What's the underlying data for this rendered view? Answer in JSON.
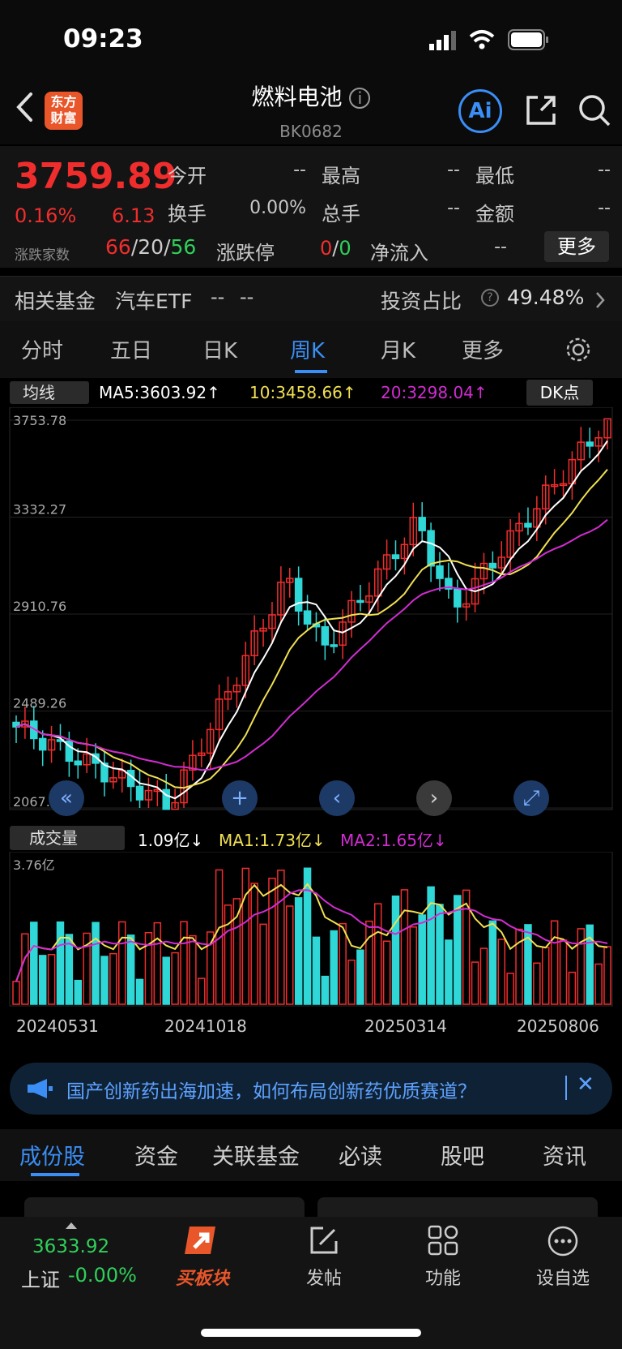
{
  "status_bar": {
    "time": "09:23"
  },
  "header": {
    "logo_text_1": "东方",
    "logo_text_2": "财富",
    "title": "燃料电池",
    "code": "BK0682",
    "ai_label": "Ai"
  },
  "quote": {
    "price": "3759.89",
    "change_pct": "0.16%",
    "change": "6.13",
    "breadth_label": "涨跌家数",
    "up": "66",
    "flat": "20",
    "down": "56",
    "rows": [
      {
        "label": "今开",
        "value": "--"
      },
      {
        "label": "最高",
        "value": "--"
      },
      {
        "label": "最低",
        "value": "--"
      },
      {
        "label": "换手",
        "value": "0.00%"
      },
      {
        "label": "总手",
        "value": "--"
      },
      {
        "label": "金额",
        "value": "--"
      }
    ],
    "limit_label": "涨跌停",
    "limit_up": "0",
    "limit_down": "0",
    "netflow_label": "净流入",
    "netflow_value": "--",
    "more_label": "更多"
  },
  "fund": {
    "label": "相关基金",
    "name": "汽车ETF",
    "v1": "--",
    "v2": "--",
    "ratio_label": "投资占比",
    "ratio": "49.48%"
  },
  "tabs": [
    {
      "label": "分时"
    },
    {
      "label": "五日"
    },
    {
      "label": "日K"
    },
    {
      "label": "周K"
    },
    {
      "label": "月K"
    },
    {
      "label": "更多"
    }
  ],
  "chart_controls": {
    "ma_selector": "均线",
    "ma5": "MA5:3603.92↑",
    "ma10": "10:3458.66↑",
    "ma20": "20:3298.04↑",
    "dk_label": "DK点",
    "vol_selector": "成交量",
    "vol_now": "1.09亿↓",
    "vol_ma1": "MA1:1.73亿↓",
    "vol_ma2": "MA2:1.65亿↓"
  },
  "chart_data": {
    "type": "candlestick",
    "y_ticks": [
      "3753.78",
      "3332.27",
      "2910.76",
      "2489.26",
      "2067.75"
    ],
    "volume_ticks": [
      "3.76亿"
    ],
    "x_ticks": [
      "20240531",
      "20241018",
      "20250314",
      "20250806"
    ],
    "ylim": [
      2067.75,
      3753.78
    ]
  },
  "news": {
    "text": "国产创新药出海加速，如何布局创新药优质赛道？"
  },
  "subtabs": [
    {
      "label": "成份股"
    },
    {
      "label": "资金"
    },
    {
      "label": "关联基金"
    },
    {
      "label": "必读"
    },
    {
      "label": "股吧"
    },
    {
      "label": "资讯"
    }
  ],
  "bottom_nav": {
    "index_value": "3633.92",
    "index_name": "上证",
    "index_change": "-0.00%",
    "items": [
      {
        "label": "买板块"
      },
      {
        "label": "发帖"
      },
      {
        "label": "功能"
      },
      {
        "label": "设自选"
      }
    ]
  },
  "colors": {
    "up": "#f02d2d",
    "down": "#2fd7d7",
    "accent": "#3a8ef5",
    "ma5": "#ffffff",
    "ma10": "#f0e050",
    "ma20": "#d22cd2"
  }
}
